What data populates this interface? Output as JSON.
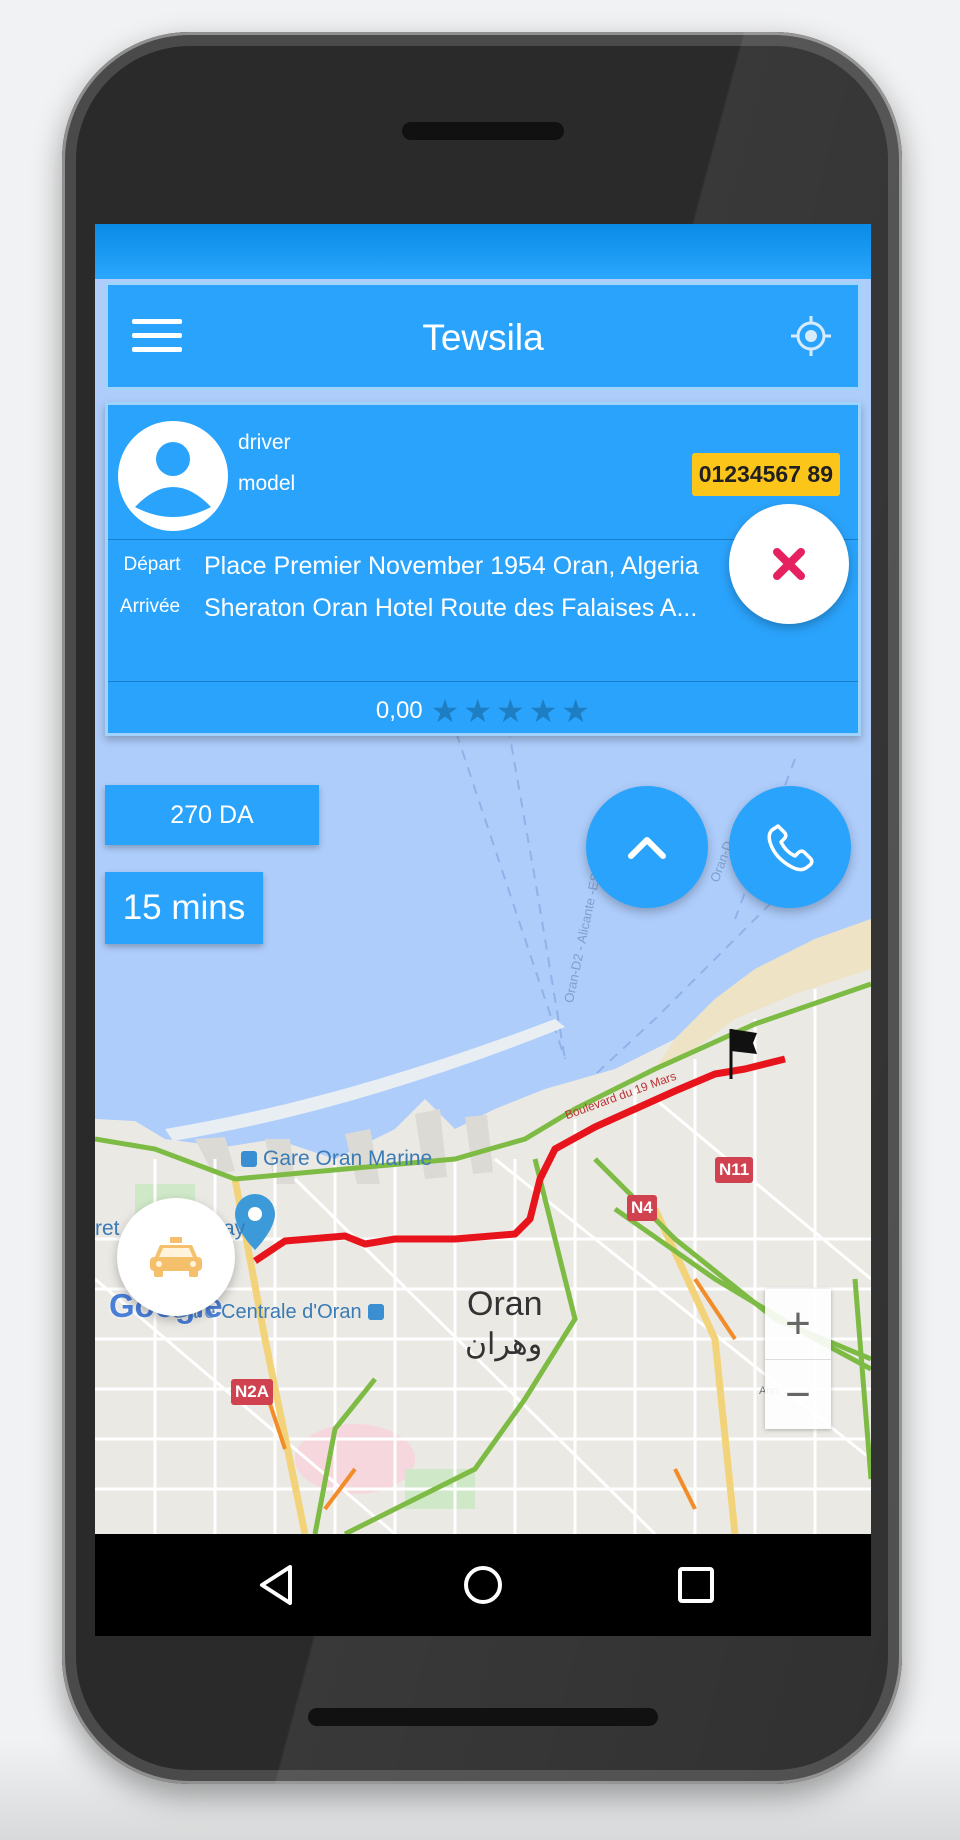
{
  "app": {
    "title": "Tewsila"
  },
  "driver": {
    "name": "driver",
    "model": "model",
    "plate": "01234567 89"
  },
  "trip": {
    "depart_label": "Départ",
    "depart_value": "Place Premier November 1954 Oran, Algeria",
    "arrivee_label": "Arrivée",
    "arrivee_value": "Sheraton Oran Hotel Route des Falaises A...",
    "rating_value": "0,00",
    "rating_stars": 0,
    "rating_max": 5,
    "fare": "270 DA",
    "duration": "15 mins"
  },
  "map": {
    "labels": {
      "gare_marine": "Gare Oran Marine",
      "gare_centrale": "Gare Centrale d'Oran",
      "city": "Oran",
      "city_ar": "وهران",
      "left_cut": "ret d",
      "left_cut2": "ay",
      "boulevard": "Boulevard du 19 Mars",
      "ferry_a": "Oran-D2 - Alicante -ES",
      "ferry_b": "Oran-D",
      "ann": "Ann"
    },
    "road_shields": [
      "N11",
      "N4",
      "N2A"
    ],
    "logo": "Google",
    "zoom_in": "+",
    "zoom_out": "−"
  },
  "colors": {
    "primary": "#2aa3fc",
    "plate": "#fcc51a",
    "cancel": "#e5215f",
    "route": "#e8141c"
  },
  "icons": {
    "menu": "hamburger-menu-icon",
    "location": "gps-target-icon",
    "cancel": "close-icon",
    "expand": "chevron-up-icon",
    "call": "phone-icon",
    "taxi": "taxi-icon",
    "destination": "flag-icon",
    "origin": "map-pin-icon"
  }
}
